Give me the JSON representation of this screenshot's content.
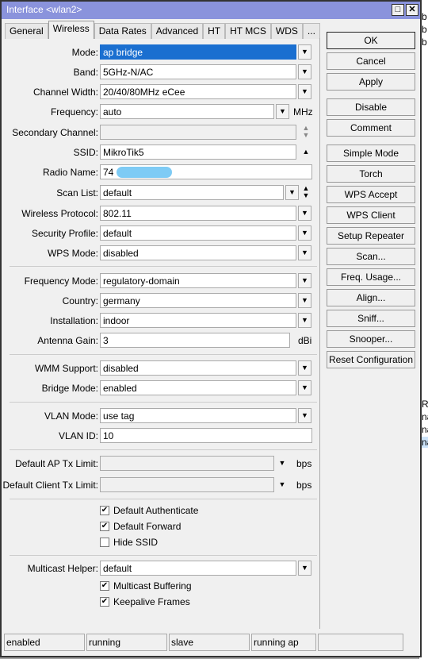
{
  "window": {
    "title": "Interface <wlan2>",
    "maximize_icon": "maximize-icon",
    "close_icon": "close-icon"
  },
  "tabs": [
    "General",
    "Wireless",
    "Data Rates",
    "Advanced",
    "HT",
    "HT MCS",
    "WDS",
    "..."
  ],
  "active_tab": "Wireless",
  "fields": {
    "mode": {
      "label": "Mode:",
      "value": "ap bridge"
    },
    "band": {
      "label": "Band:",
      "value": "5GHz-N/AC"
    },
    "channel_width": {
      "label": "Channel Width:",
      "value": "20/40/80MHz eCee"
    },
    "frequency": {
      "label": "Frequency:",
      "value": "auto",
      "unit": "MHz"
    },
    "secondary_channel": {
      "label": "Secondary Channel:",
      "value": ""
    },
    "ssid": {
      "label": "SSID:",
      "value": "MikroTik5"
    },
    "radio_name": {
      "label": "Radio Name:",
      "value": "74"
    },
    "scan_list": {
      "label": "Scan List:",
      "value": "default"
    },
    "wireless_protocol": {
      "label": "Wireless Protocol:",
      "value": "802.11"
    },
    "security_profile": {
      "label": "Security Profile:",
      "value": "default"
    },
    "wps_mode": {
      "label": "WPS Mode:",
      "value": "disabled"
    },
    "frequency_mode": {
      "label": "Frequency Mode:",
      "value": "regulatory-domain"
    },
    "country": {
      "label": "Country:",
      "value": "germany"
    },
    "installation": {
      "label": "Installation:",
      "value": "indoor"
    },
    "antenna_gain": {
      "label": "Antenna Gain:",
      "value": "3",
      "unit": "dBi"
    },
    "wmm_support": {
      "label": "WMM Support:",
      "value": "disabled"
    },
    "bridge_mode": {
      "label": "Bridge Mode:",
      "value": "enabled"
    },
    "vlan_mode": {
      "label": "VLAN Mode:",
      "value": "use tag"
    },
    "vlan_id": {
      "label": "VLAN ID:",
      "value": "10"
    },
    "default_ap_tx_limit": {
      "label": "Default AP Tx Limit:",
      "value": "",
      "unit": "bps"
    },
    "default_client_tx_limit": {
      "label": "Default Client Tx Limit:",
      "value": "",
      "unit": "bps"
    },
    "multicast_helper": {
      "label": "Multicast Helper:",
      "value": "default"
    }
  },
  "checkboxes": [
    {
      "label": "Default Authenticate",
      "checked": true
    },
    {
      "label": "Default Forward",
      "checked": true
    },
    {
      "label": "Hide SSID",
      "checked": false
    },
    {
      "label": "Multicast Buffering",
      "checked": true
    },
    {
      "label": "Keepalive Frames",
      "checked": true
    }
  ],
  "buttons": [
    "OK",
    "Cancel",
    "Apply",
    "Disable",
    "Comment",
    "Simple Mode",
    "Torch",
    "WPS Accept",
    "WPS Client",
    "Setup Repeater",
    "Scan...",
    "Freq. Usage...",
    "Align...",
    "Sniff...",
    "Snooper...",
    "Reset Configuration"
  ],
  "status": [
    "enabled",
    "running",
    "slave",
    "running ap",
    ""
  ],
  "background": {
    "lines": [
      "b",
      "b",
      "b",
      "RI",
      "na",
      "na",
      "na"
    ]
  },
  "colors": {
    "titlebar": "#8a93dc",
    "selection": "#1a6fd0"
  }
}
